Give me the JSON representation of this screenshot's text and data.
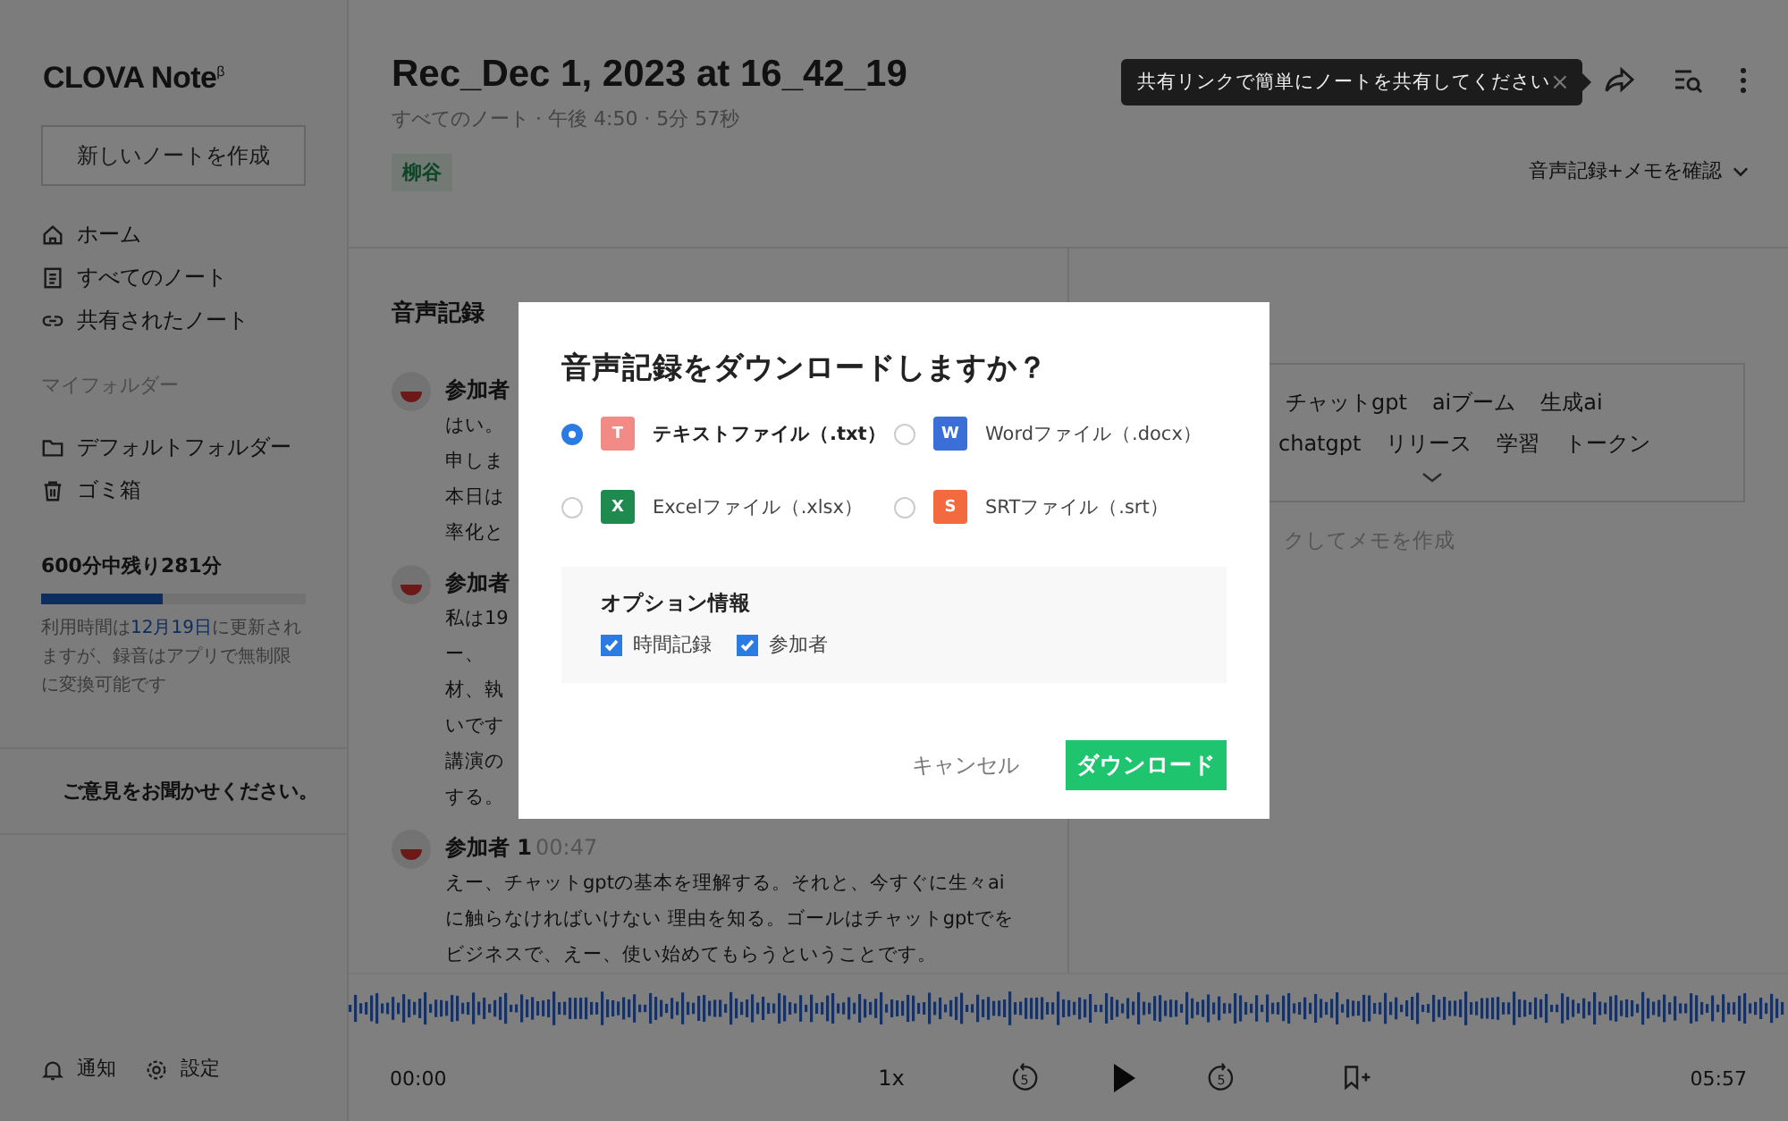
{
  "sidebar": {
    "logo": "CLOVA Note",
    "logo_mark": "β",
    "new_note_button": "新しいノートを作成",
    "nav": [
      {
        "kind": "home",
        "label": "ホーム"
      },
      {
        "kind": "doc",
        "label": "すべてのノート"
      },
      {
        "kind": "link",
        "label": "共有されたノート"
      }
    ],
    "folders_heading": "マイフォルダー",
    "folders": [
      {
        "kind": "folder",
        "label": "デフォルトフォルダー"
      },
      {
        "kind": "trash",
        "label": "ゴミ箱"
      }
    ],
    "usage": {
      "title": "600分中残り281分",
      "level": 0.46,
      "note_before": "利用時間は",
      "note_link": "12月19日",
      "note_after": "に更新されますが、録音はアプリで無制限に変換可能です"
    },
    "feedback": "ご意見をお聞かせください。",
    "footer": [
      {
        "kind": "bell",
        "label": "通知"
      },
      {
        "kind": "gear",
        "label": "設定"
      }
    ]
  },
  "header": {
    "title": "Rec_Dec 1, 2023 at 16_42_19",
    "meta": "すべてのノート · 午後 4:50 · 5分 57秒",
    "tag": "柳谷",
    "tooltip": "共有リンクで簡単にノートを共有してください",
    "tooltip_close": "×",
    "view_select": "音声記録+メモを確認"
  },
  "transcript": {
    "heading": "音声記録",
    "segments": [
      {
        "speaker": "参加者",
        "lines": [
          "はい。",
          "申しま",
          "本日は",
          "率化と"
        ]
      },
      {
        "speaker": "参加者",
        "lines": [
          "私は19",
          "ー、",
          "材、執",
          "いです",
          "講演の",
          "する。"
        ]
      },
      {
        "speaker": "参加者 1",
        "time": "00:47",
        "lines": [
          "えー、チャットgptの基本を理解する。それと、今すぐに生々ai",
          "に触らなければいけない 理由を知る。ゴールはチャットgptでを",
          "ビジネスで、えー、使い始めてもらうということです。"
        ]
      }
    ]
  },
  "memo": {
    "keyword_rows": [
      [
        "チャットgpt",
        "aiブーム",
        "生成ai"
      ],
      [
        "chatgpt",
        "リリース",
        "学習",
        "トークン"
      ]
    ],
    "hint": "クしてメモを作成"
  },
  "player": {
    "start": "00:00",
    "speed": "1x",
    "rewind_seconds": "5",
    "forward_seconds": "5",
    "end": "05:57"
  },
  "dialog": {
    "title": "音声記録をダウンロードしますか？",
    "options": [
      {
        "badge": "T",
        "label": "テキストファイル（.txt）",
        "color": "#f28b86",
        "selected": true
      },
      {
        "badge": "W",
        "label": "Wordファイル（.docx）",
        "color": "#3a6fd8",
        "selected": false
      },
      {
        "badge": "X",
        "label": "Excelファイル（.xlsx）",
        "color": "#1e8a4e",
        "selected": false
      },
      {
        "badge": "S",
        "label": "SRTファイル（.srt）",
        "color": "#f26a3d",
        "selected": false
      }
    ],
    "option_section": {
      "title": "オプション情報",
      "checks": [
        {
          "label": "時間記録",
          "checked": true
        },
        {
          "label": "参加者",
          "checked": true
        }
      ]
    },
    "cancel": "キャンセル",
    "download": "ダウンロード"
  }
}
